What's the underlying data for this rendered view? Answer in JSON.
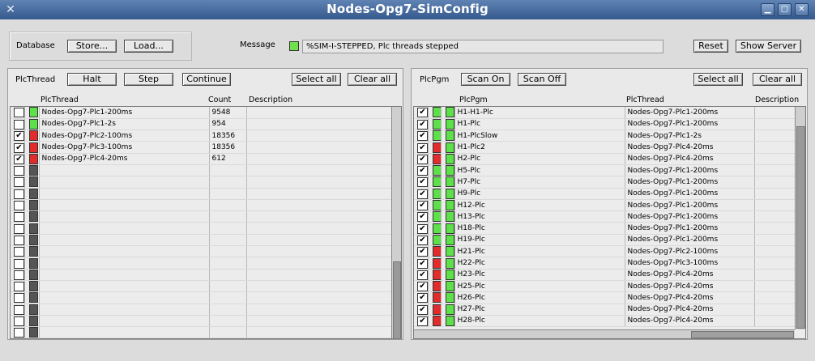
{
  "window": {
    "title": "Nodes-Opg7-SimConfig",
    "icon": "x-app-icon",
    "controls": [
      "minimize",
      "maximize",
      "close"
    ]
  },
  "database": {
    "label": "Database",
    "store_label": "Store...",
    "load_label": "Load..."
  },
  "message": {
    "label": "Message",
    "status_color": "#6fe04a",
    "text": "%SIM-I-STEPPED, Plc threads stepped"
  },
  "top_right": {
    "reset_label": "Reset",
    "show_server_label": "Show Server"
  },
  "plcthread": {
    "label": "PlcThread",
    "halt_label": "Halt",
    "step_label": "Step",
    "continue_label": "Continue",
    "select_all_label": "Select all",
    "clear_all_label": "Clear all",
    "columns": [
      "PlcThread",
      "Count",
      "Description"
    ],
    "rows": [
      {
        "checked": false,
        "status": "on",
        "name": "Nodes-Opg7-Plc1-200ms",
        "count": "9548",
        "description": ""
      },
      {
        "checked": false,
        "status": "on",
        "name": "Nodes-Opg7-Plc1-2s",
        "count": "954",
        "description": ""
      },
      {
        "checked": true,
        "status": "off",
        "name": "Nodes-Opg7-Plc2-100ms",
        "count": "18356",
        "description": ""
      },
      {
        "checked": true,
        "status": "off",
        "name": "Nodes-Opg7-Plc3-100ms",
        "count": "18356",
        "description": ""
      },
      {
        "checked": true,
        "status": "off",
        "name": "Nodes-Opg7-Plc4-20ms",
        "count": "612",
        "description": ""
      }
    ],
    "empty_rows": 15
  },
  "plcpgm": {
    "label": "PlcPgm",
    "scan_on_label": "Scan On",
    "scan_off_label": "Scan Off",
    "select_all_label": "Select all",
    "clear_all_label": "Clear all",
    "columns": [
      "PlcPgm",
      "PlcThread",
      "Description"
    ],
    "rows": [
      {
        "checked": true,
        "s1": "on",
        "s2": "on",
        "name": "H1-H1-Plc",
        "thread": "Nodes-Opg7-Plc1-200ms"
      },
      {
        "checked": true,
        "s1": "on",
        "s2": "on",
        "name": "H1-Plc",
        "thread": "Nodes-Opg7-Plc1-200ms"
      },
      {
        "checked": true,
        "s1": "on",
        "s2": "on",
        "name": "H1-PlcSlow",
        "thread": "Nodes-Opg7-Plc1-2s"
      },
      {
        "checked": true,
        "s1": "off",
        "s2": "on",
        "name": "H1-Plc2",
        "thread": "Nodes-Opg7-Plc4-20ms"
      },
      {
        "checked": true,
        "s1": "off",
        "s2": "on",
        "name": "H2-Plc",
        "thread": "Nodes-Opg7-Plc4-20ms"
      },
      {
        "checked": true,
        "s1": "on",
        "s2": "on",
        "name": "H5-Plc",
        "thread": "Nodes-Opg7-Plc1-200ms"
      },
      {
        "checked": true,
        "s1": "on",
        "s2": "on",
        "name": "H7-Plc",
        "thread": "Nodes-Opg7-Plc1-200ms"
      },
      {
        "checked": true,
        "s1": "on",
        "s2": "on",
        "name": "H9-Plc",
        "thread": "Nodes-Opg7-Plc1-200ms"
      },
      {
        "checked": true,
        "s1": "on",
        "s2": "on",
        "name": "H12-Plc",
        "thread": "Nodes-Opg7-Plc1-200ms"
      },
      {
        "checked": true,
        "s1": "on",
        "s2": "on",
        "name": "H13-Plc",
        "thread": "Nodes-Opg7-Plc1-200ms"
      },
      {
        "checked": true,
        "s1": "on",
        "s2": "on",
        "name": "H18-Plc",
        "thread": "Nodes-Opg7-Plc1-200ms"
      },
      {
        "checked": true,
        "s1": "on",
        "s2": "on",
        "name": "H19-Plc",
        "thread": "Nodes-Opg7-Plc1-200ms"
      },
      {
        "checked": true,
        "s1": "off",
        "s2": "on",
        "name": "H21-Plc",
        "thread": "Nodes-Opg7-Plc2-100ms"
      },
      {
        "checked": true,
        "s1": "off",
        "s2": "on",
        "name": "H22-Plc",
        "thread": "Nodes-Opg7-Plc3-100ms"
      },
      {
        "checked": true,
        "s1": "off",
        "s2": "on",
        "name": "H23-Plc",
        "thread": "Nodes-Opg7-Plc4-20ms"
      },
      {
        "checked": true,
        "s1": "off",
        "s2": "on",
        "name": "H25-Plc",
        "thread": "Nodes-Opg7-Plc4-20ms"
      },
      {
        "checked": true,
        "s1": "off",
        "s2": "on",
        "name": "H26-Plc",
        "thread": "Nodes-Opg7-Plc4-20ms"
      },
      {
        "checked": true,
        "s1": "off",
        "s2": "on",
        "name": "H27-Plc",
        "thread": "Nodes-Opg7-Plc4-20ms"
      },
      {
        "checked": true,
        "s1": "off",
        "s2": "on",
        "name": "H28-Plc",
        "thread": "Nodes-Opg7-Plc4-20ms"
      }
    ]
  },
  "colors": {
    "titlebar": "#46699c",
    "status_on": "#5ee04a",
    "status_off": "#e22b2b",
    "status_idle": "#555555"
  }
}
